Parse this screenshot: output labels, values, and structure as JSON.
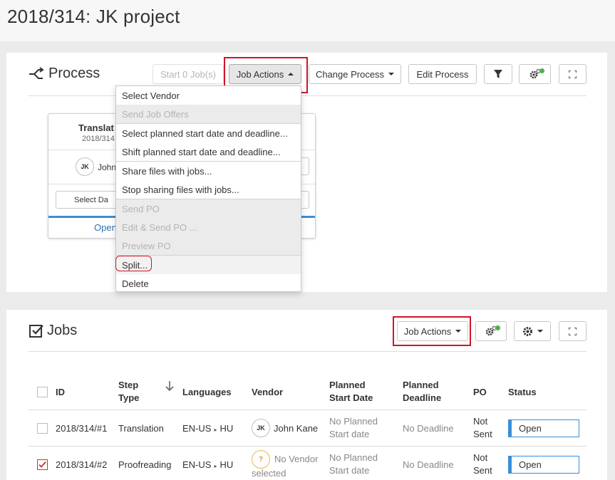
{
  "page": {
    "title": "2018/314:  JK project"
  },
  "process_panel": {
    "title": "Process",
    "start_jobs_label": "Start 0 Job(s)",
    "job_actions_label": "Job Actions",
    "change_process_label": "Change Process",
    "edit_process_label": "Edit Process",
    "card": {
      "title": "Translat",
      "subtitle": "2018/314",
      "vendor_initials": "JK",
      "vendor_name": "John",
      "select_label": "Select Da",
      "status_link": "Open"
    },
    "dropdown": [
      {
        "label": "Select Vendor",
        "disabled": false
      },
      {
        "label": "Send Job Offers",
        "disabled": true
      },
      {
        "label": "Select planned start date and deadline...",
        "disabled": false
      },
      {
        "label": "Shift planned start date and deadline...",
        "disabled": false
      },
      {
        "label": "Share files with jobs...",
        "disabled": false
      },
      {
        "label": "Stop sharing files with jobs...",
        "disabled": false
      },
      {
        "label": "Send PO",
        "disabled": true
      },
      {
        "label": "Edit & Send PO ...",
        "disabled": true
      },
      {
        "label": "Preview PO",
        "disabled": true
      },
      {
        "label": "Split...",
        "disabled": false
      },
      {
        "label": "Delete",
        "disabled": false
      }
    ]
  },
  "jobs_panel": {
    "title": "Jobs",
    "job_actions_label": "Job Actions",
    "columns": {
      "id": "ID",
      "step_type": [
        "Step",
        "Type"
      ],
      "languages": "Languages",
      "vendor": "Vendor",
      "planned_start": [
        "Planned",
        "Start Date"
      ],
      "planned_deadline": [
        "Planned",
        "Deadline"
      ],
      "po": "PO",
      "status": "Status"
    },
    "rows": [
      {
        "id": "2018/314/#1",
        "step_type": "Translation",
        "lang_from": "EN-US",
        "lang_to": "HU",
        "vendor_initials": "JK",
        "vendor": "John Kane",
        "vendor_line2": "",
        "start": [
          "No Planned",
          "Start date"
        ],
        "deadline": "No Deadline",
        "po": [
          "Not",
          "Sent"
        ],
        "status": "Open",
        "checked": false
      },
      {
        "id": "2018/314/#2",
        "step_type": "Proofreading",
        "lang_from": "EN-US",
        "lang_to": "HU",
        "vendor_initials": "?",
        "vendor": "No Vendor",
        "vendor_line2": "selected",
        "start": [
          "No Planned",
          "Start date"
        ],
        "deadline": "No Deadline",
        "po": [
          "Not",
          "Sent"
        ],
        "status": "Open",
        "checked": true
      }
    ]
  },
  "colors": {
    "accent_blue": "#3a8fd6",
    "highlight_red": "#d0142b",
    "status_green": "#4caf50"
  }
}
